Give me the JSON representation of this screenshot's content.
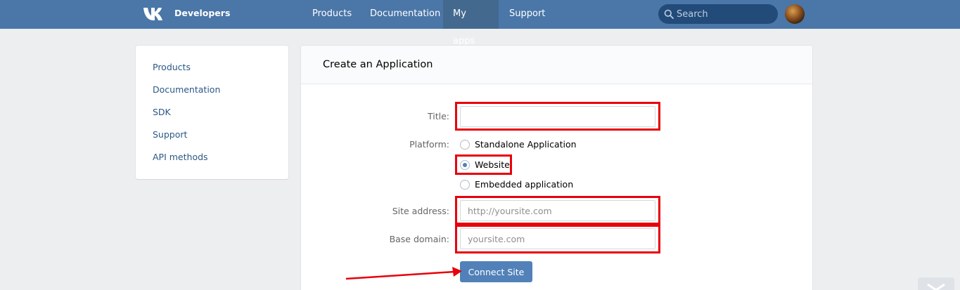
{
  "header": {
    "brand": "Developers",
    "nav": [
      "Products",
      "Documentation",
      "My apps",
      "Support"
    ],
    "active_nav": "My apps",
    "search_placeholder": "Search",
    "colors": {
      "bar": "#4a76a8",
      "active": "#43698f"
    }
  },
  "sidebar": {
    "items": [
      "Products",
      "Documentation",
      "SDK",
      "Support",
      "API methods"
    ]
  },
  "form": {
    "title": "Create an Application",
    "title_label": "Title:",
    "title_value": "",
    "platform_label": "Platform:",
    "platforms": [
      "Standalone Application",
      "Website",
      "Embedded application"
    ],
    "selected_platform": "Website",
    "site_label": "Site address:",
    "site_placeholder": "http://yoursite.com",
    "domain_label": "Base domain:",
    "domain_placeholder": "yoursite.com",
    "submit": "Connect Site"
  },
  "annotations": {
    "highlight_color": "#e8000b",
    "highlighted": [
      "title-field",
      "radio-website",
      "site-address-field",
      "base-domain-field"
    ],
    "arrow_target": "connect-site-button"
  }
}
